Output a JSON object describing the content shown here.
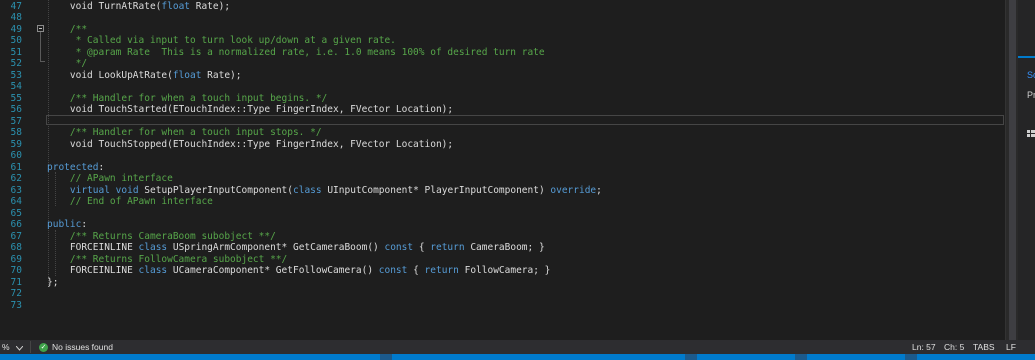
{
  "editor": {
    "lines": [
      {
        "num": "47",
        "html": "    <span>void TurnAtRate(</span><span class=\"kw\">float</span><span> Rate);</span>"
      },
      {
        "num": "48",
        "html": ""
      },
      {
        "num": "49",
        "html": "    <span class=\"cm\">/**</span>"
      },
      {
        "num": "50",
        "html": "    <span class=\"cm\"> * Called via input to turn look up/down at a given rate.</span>"
      },
      {
        "num": "51",
        "html": "    <span class=\"cm\"> * @param Rate  This is a normalized rate, i.e. 1.0 means 100% of desired turn rate</span>"
      },
      {
        "num": "52",
        "html": "    <span class=\"cm\"> */</span>"
      },
      {
        "num": "53",
        "html": "    <span>void LookUpAtRate(</span><span class=\"kw\">float</span><span> Rate);</span>"
      },
      {
        "num": "54",
        "html": ""
      },
      {
        "num": "55",
        "html": "    <span class=\"cm\">/** Handler for when a touch input begins. */</span>"
      },
      {
        "num": "56",
        "html": "    <span>void TouchStarted(ETouchIndex::Type FingerIndex, FVector Location);</span>"
      },
      {
        "num": "57",
        "html": ""
      },
      {
        "num": "58",
        "html": "    <span class=\"cm\">/** Handler for when a touch input stops. */</span>"
      },
      {
        "num": "59",
        "html": "    <span>void TouchStopped(ETouchIndex::Type FingerIndex, FVector Location);</span>"
      },
      {
        "num": "60",
        "html": ""
      },
      {
        "num": "61",
        "html": "<span class=\"kw\">protected</span><span>:</span>"
      },
      {
        "num": "62",
        "html": "    <span class=\"cm\">// APawn interface</span>"
      },
      {
        "num": "63",
        "html": "    <span class=\"kw\">virtual</span><span> </span><span class=\"kw\">void</span><span> SetupPlayerInputComponent(</span><span class=\"kw\">class</span><span> UInputComponent* PlayerInputComponent) </span><span class=\"kw\">override</span><span>;</span>"
      },
      {
        "num": "64",
        "html": "    <span class=\"cm\">// End of APawn interface</span>"
      },
      {
        "num": "65",
        "html": ""
      },
      {
        "num": "66",
        "html": "<span class=\"kw\">public</span><span>:</span>"
      },
      {
        "num": "67",
        "html": "    <span class=\"cm\">/** Returns CameraBoom subobject **/</span>"
      },
      {
        "num": "68",
        "html": "    <span>FORCEINLINE </span><span class=\"kw\">class</span><span> USpringArmComponent* GetCameraBoom() </span><span class=\"kw\">const</span><span> { </span><span class=\"kw\">return</span><span> CameraBoom; }</span>"
      },
      {
        "num": "69",
        "html": "    <span class=\"cm\">/** Returns FollowCamera subobject **/</span>"
      },
      {
        "num": "70",
        "html": "    <span>FORCEINLINE </span><span class=\"kw\">class</span><span> UCameraComponent* GetFollowCamera() </span><span class=\"kw\">const</span><span> { </span><span class=\"kw\">return</span><span> FollowCamera; }</span>"
      },
      {
        "num": "71",
        "html": "<span>};</span>"
      },
      {
        "num": "72",
        "html": ""
      },
      {
        "num": "73",
        "html": ""
      }
    ]
  },
  "right_panel": {
    "tab_label": "Sc",
    "props_label": "Pr",
    "icon": "properties-icon"
  },
  "statusbar": {
    "zoom": "%",
    "zoom_dropdown_icon": "chevron-down-icon",
    "issues_icon": "check-circle-icon",
    "issues_text": "No issues found",
    "line": "Ln: 57",
    "col": "Ch: 5",
    "indent": "TABS",
    "eol": "LF"
  },
  "colors": {
    "keyword": "#569cd6",
    "comment": "#57a64a",
    "line_number": "#2b91af",
    "accent": "#007acc",
    "ok": "#3fa24a"
  }
}
